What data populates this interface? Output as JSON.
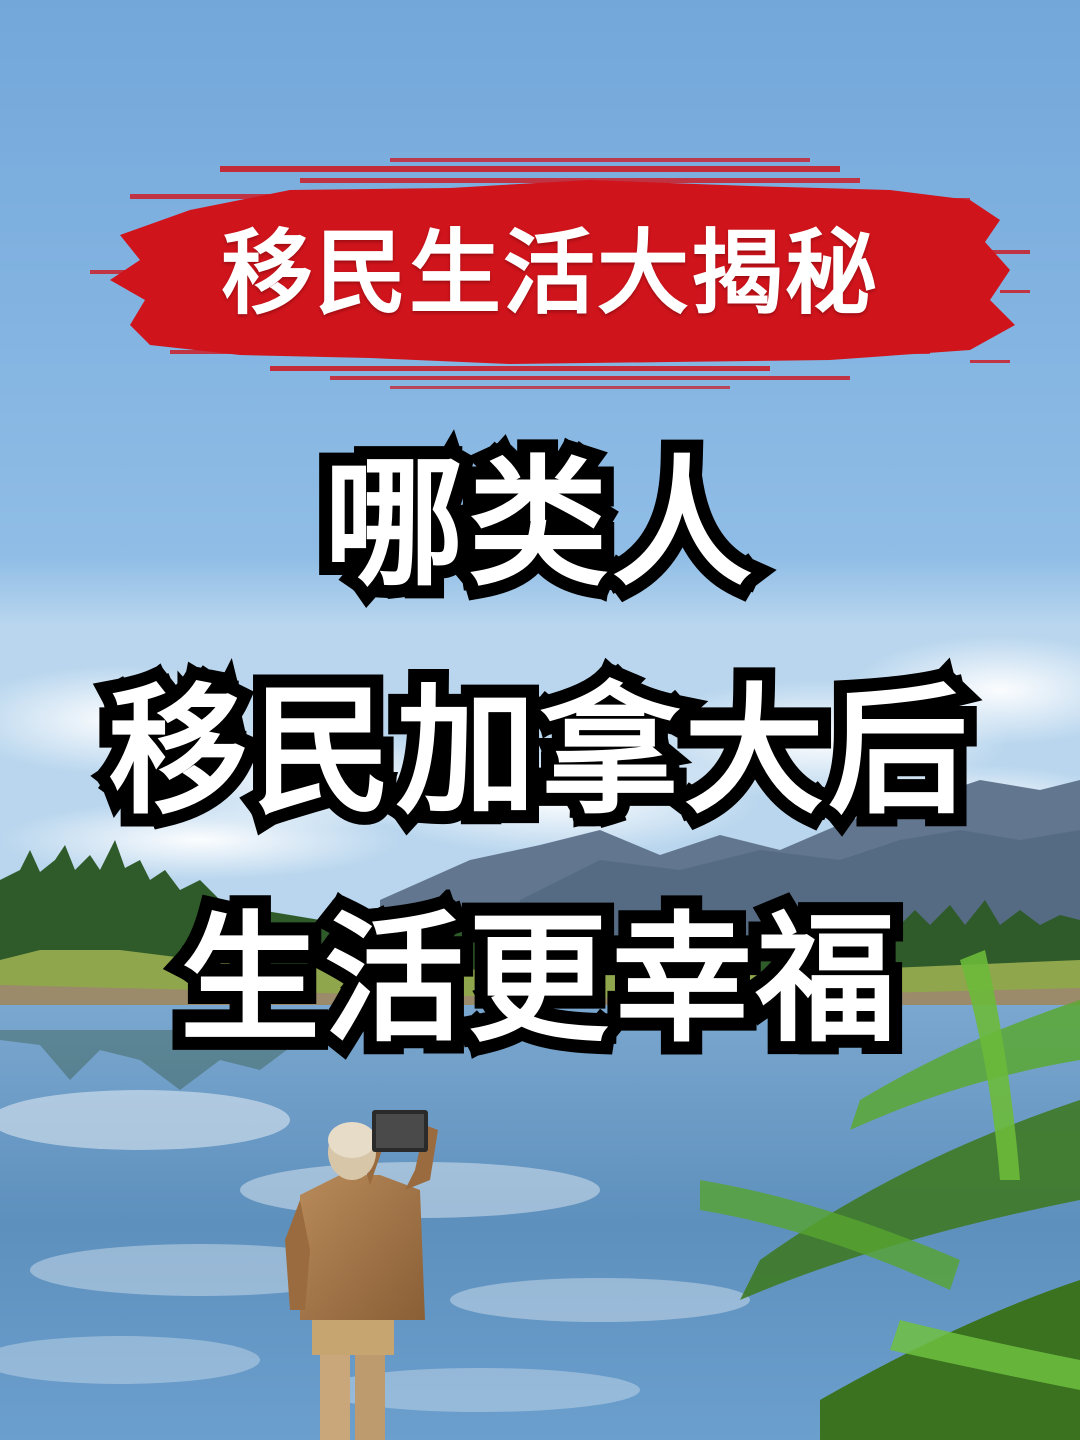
{
  "banner": {
    "text": "移民生活大揭秘",
    "brush_color": "#d0141c"
  },
  "headline": {
    "line1": "哪类人",
    "line2": "移民加拿大后",
    "line3": "生活更幸福"
  },
  "scene": {
    "sky_top": "#73a7da",
    "sky_bottom": "#9fc7ea",
    "mountain_color": "#5b6f86",
    "forest_color": "#2f5a2a",
    "lake_color": "#5f8fb8",
    "pine_color": "#4f9a2c",
    "icons": [
      "person-photographing",
      "tablet",
      "mountains",
      "forest",
      "lake",
      "pine-branch",
      "clouds"
    ]
  }
}
